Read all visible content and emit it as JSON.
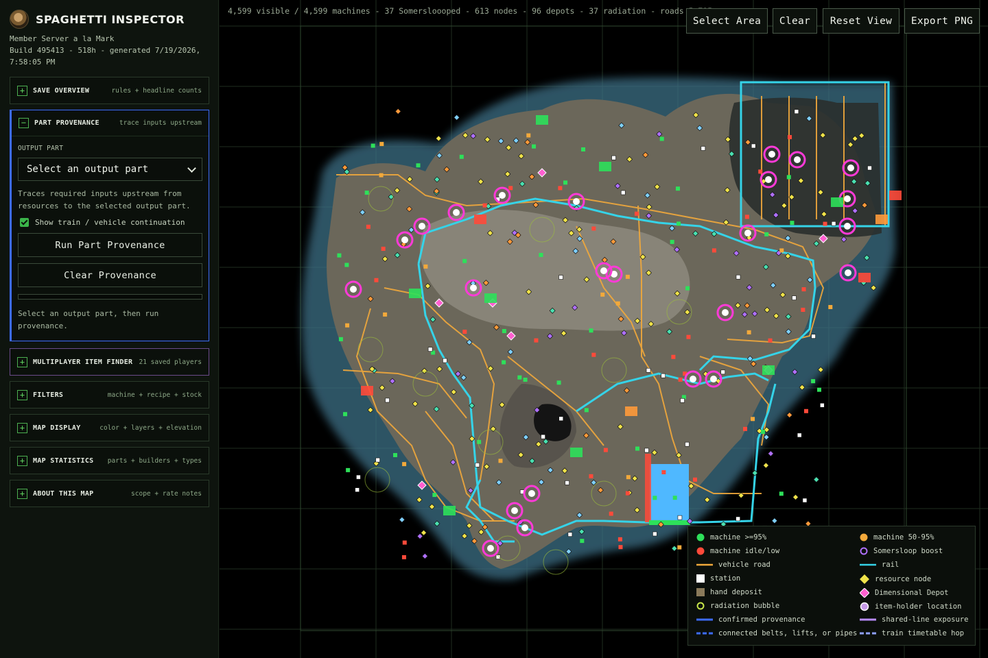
{
  "app": {
    "title": "SPAGHETTI INSPECTOR",
    "server": "Member Server a la Mark",
    "build_line": "Build 495413 - 518h - generated 7/19/2026,",
    "build_time": "7:58:05 PM"
  },
  "sections": {
    "save_overview": {
      "toggle": "+",
      "title": "SAVE OVERVIEW",
      "hint": "rules + headline counts"
    },
    "part_provenance": {
      "toggle": "−",
      "title": "PART PROVENANCE",
      "hint": "trace inputs upstream",
      "output_label": "OUTPUT PART",
      "select_value": "Select an output part",
      "description": "Traces required inputs upstream from resources to the selected output part.",
      "checkbox_label": "Show train / vehicle continuation",
      "checkbox_checked": true,
      "run_button": "Run Part Provenance",
      "clear_button": "Clear Provenance",
      "status": "Select an output part, then run provenance."
    },
    "multiplayer": {
      "toggle": "+",
      "title": "MULTIPLAYER ITEM FINDER",
      "hint": "21 saved players"
    },
    "filters": {
      "toggle": "+",
      "title": "FILTERS",
      "hint": "machine + recipe + stock"
    },
    "map_display": {
      "toggle": "+",
      "title": "MAP DISPLAY",
      "hint": "color + layers + elevation"
    },
    "map_statistics": {
      "toggle": "+",
      "title": "MAP STATISTICS",
      "hint": "parts + builders + types"
    },
    "about": {
      "toggle": "+",
      "title": "ABOUT THIS MAP",
      "hint": "scope + rate notes"
    }
  },
  "map": {
    "stats": "4,599 visible / 4,599 machines - 37 Somersloooped - 613 nodes - 96 depots - 37 radiation - roads 5,715",
    "toolbar": {
      "select_area": "Select Area",
      "clear": "Clear",
      "reset_view": "Reset View",
      "export_png": "Export PNG"
    }
  },
  "legend": {
    "machine_high": "machine >=95%",
    "machine_mid": "machine 50-95%",
    "machine_idle": "machine idle/low",
    "somersloop": "Somersloop boost",
    "vehicle_road": "vehicle road",
    "rail": "rail",
    "station": "station",
    "resource_node": "resource node",
    "hand_deposit": "hand deposit",
    "dimensional_depot": "Dimensional Depot",
    "radiation": "radiation bubble",
    "item_holder": "item-holder location",
    "confirmed": "confirmed provenance",
    "shared_line": "shared-line exposure",
    "connected": "connected belts, lifts, or pipes",
    "train_hop": "train timetable hop"
  },
  "colors": {
    "accent_blue": "#3d6cff",
    "green": "#2ee05a",
    "orange": "#f2a93b",
    "red": "#ff4a3a",
    "purple": "#b070ff",
    "rail": "#35d3e8",
    "node": "#f0e34a",
    "depot": "#ff5fd0"
  }
}
